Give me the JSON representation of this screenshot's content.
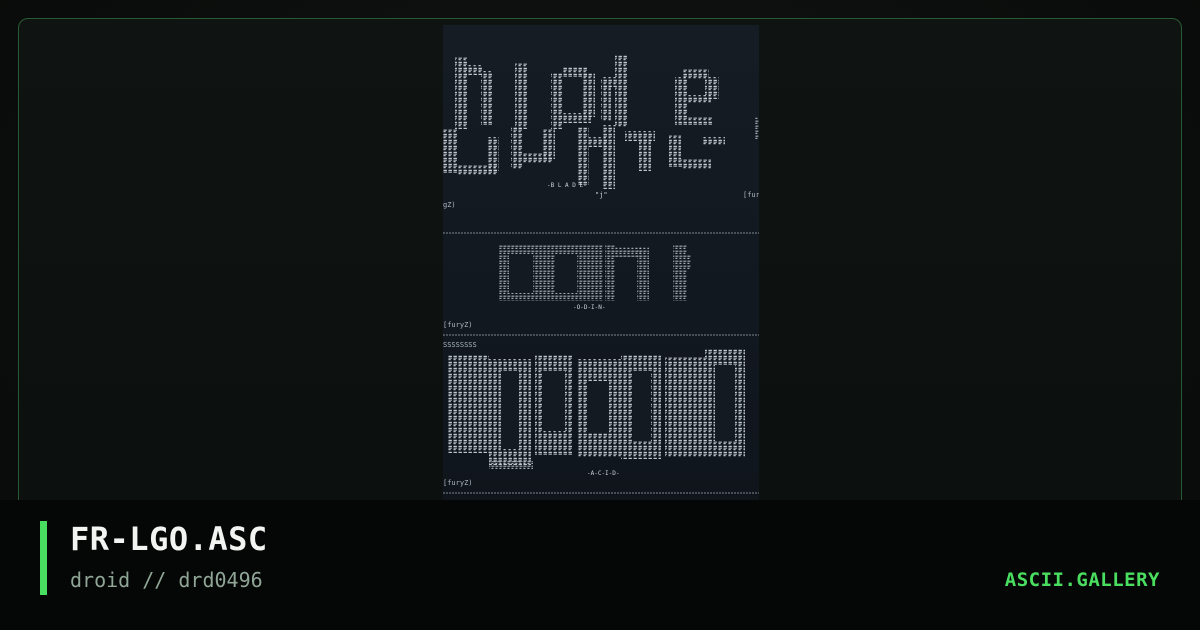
{
  "artwork": {
    "panels": [
      {
        "label": "-BLADE-",
        "glyph": "\"j\"",
        "credit_left": "gZ)",
        "credit_right": "[fur"
      },
      {
        "label": "-O-D-I-N-",
        "credit_left": "[furyZ)"
      },
      {
        "label": "-A-C-I-D-",
        "credit_left": "[furyZ)",
        "header": "SSSSSSSS"
      }
    ]
  },
  "footer": {
    "title": "FR-LGO.ASC",
    "subtitle": "droid // drd0496",
    "brand": "ASCII.GALLERY"
  },
  "colors": {
    "accent": "#4ade60",
    "frame_border": "#2a5a33",
    "art_background": "#141a22",
    "ascii_text": "#c9d1d9"
  }
}
